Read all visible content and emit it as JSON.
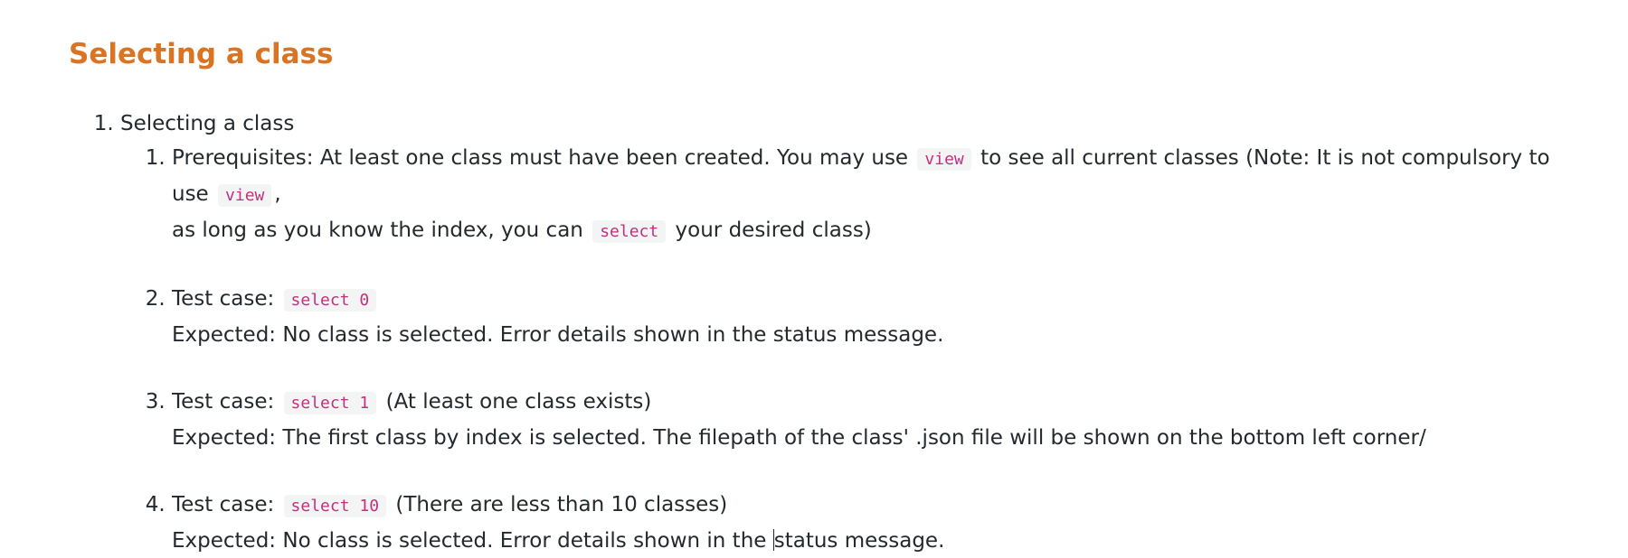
{
  "section": {
    "title": "Selecting a class"
  },
  "list": {
    "item_label": "Selecting a class",
    "steps": [
      {
        "t1": "Prerequisites: At least one class must have been created. You may use",
        "c1": "view",
        "t2": "to see all current classes (Note: It is not compulsory to use",
        "c2": "view",
        "t3": ",",
        "t4": "as long as you know the index, you can",
        "c3": "select",
        "t5": "your desired class)"
      },
      {
        "label": "Test case:",
        "code": "select 0",
        "suffix": "",
        "expected": "Expected: No class is selected. Error details shown in the status message."
      },
      {
        "label": "Test case:",
        "code": "select 1",
        "suffix": "(At least one class exists)",
        "expected": "Expected: The first class by index is selected. The filepath of the class' .json file will be shown on the bottom left corner/"
      },
      {
        "label": "Test case:",
        "code": "select 10",
        "suffix": "(There are less than 10 classes)",
        "expected_a": "Expected: No class is selected. Error details shown in the ",
        "expected_b": "status message."
      }
    ]
  }
}
